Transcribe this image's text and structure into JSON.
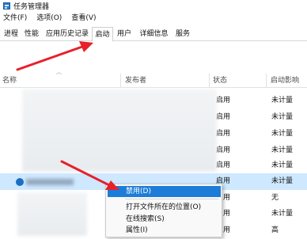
{
  "window": {
    "title": "任务管理器",
    "icon": "task-manager-icon"
  },
  "menubar": {
    "items": [
      "文件(F)",
      "选项(O)",
      "查看(V)"
    ]
  },
  "tabs": {
    "items": [
      "进程",
      "性能",
      "应用历史记录",
      "启动",
      "用户",
      "详细信息",
      "服务"
    ],
    "active": "启动"
  },
  "columns": {
    "name": "名称",
    "publisher": "发布者",
    "status": "状态",
    "impact": "启动影响"
  },
  "rows": [
    {
      "status": "启用",
      "impact": "未计量"
    },
    {
      "status": "启用",
      "impact": "未计量"
    },
    {
      "status": "启用",
      "impact": "未计量"
    },
    {
      "status": "启用",
      "impact": "未计量"
    },
    {
      "status": "启用",
      "impact": "未计量"
    },
    {
      "status": "启用",
      "impact": "未计量"
    },
    {
      "status": "启用",
      "impact": "无"
    },
    {
      "status": "启用",
      "impact": "未计量"
    },
    {
      "status": "启用",
      "impact": "高"
    }
  ],
  "context_menu": {
    "items": [
      "禁用(D)",
      "打开文件所在的位置(O)",
      "在线搜索(S)",
      "属性(I)"
    ],
    "hovered": "禁用(D)"
  },
  "colors": {
    "selection": "#cde8ff",
    "menu_hover": "#1c7dd8",
    "arrow": "#e8202a"
  }
}
